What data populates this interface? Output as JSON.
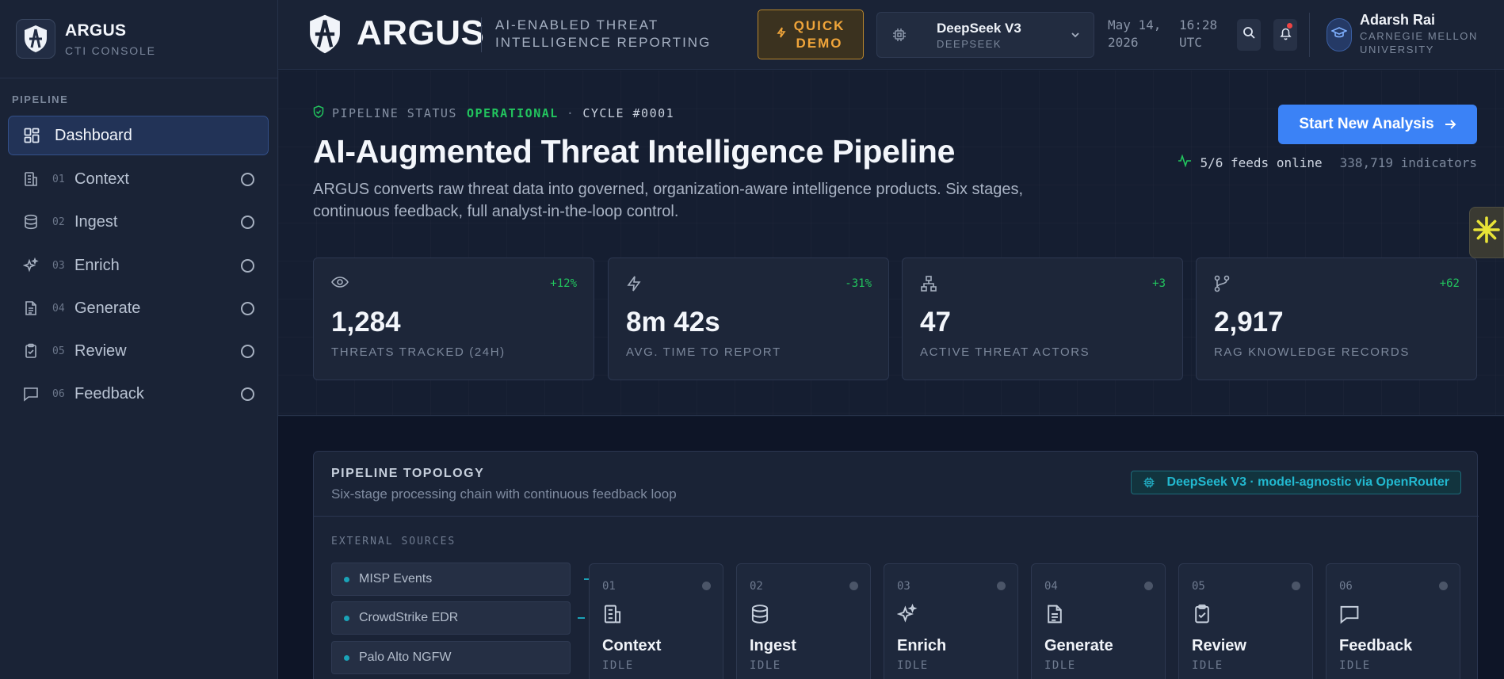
{
  "sidebar": {
    "brand": {
      "name": "ARGUS",
      "subtitle": "CTI CONSOLE"
    },
    "section_label": "PIPELINE",
    "items": [
      {
        "num": "",
        "label": "Dashboard",
        "icon": "dashboard-icon",
        "active": true
      },
      {
        "num": "01",
        "label": "Context",
        "icon": "building-icon"
      },
      {
        "num": "02",
        "label": "Ingest",
        "icon": "database-icon"
      },
      {
        "num": "03",
        "label": "Enrich",
        "icon": "sparkles-icon"
      },
      {
        "num": "04",
        "label": "Generate",
        "icon": "document-icon"
      },
      {
        "num": "05",
        "label": "Review",
        "icon": "clipboard-check-icon"
      },
      {
        "num": "06",
        "label": "Feedback",
        "icon": "message-icon"
      }
    ]
  },
  "header": {
    "name": "ARGUS",
    "tagline_line1": "AI-ENABLED THREAT",
    "tagline_line2": "INTELLIGENCE REPORTING",
    "quick_demo_line1": "QUICK",
    "quick_demo_line2": "DEMO",
    "model": {
      "name": "DeepSeek V3",
      "provider": "DEEPSEEK"
    },
    "date_line1": "May 14,",
    "date_line2": "2026",
    "time_line1": "16:28",
    "time_line2": "UTC",
    "user": {
      "name": "Adarsh Rai",
      "org_line1": "CARNEGIE MELLON",
      "org_line2": "UNIVERSITY"
    }
  },
  "hero": {
    "status_label": "PIPELINE STATUS",
    "status_value": "OPERATIONAL",
    "separator": "·",
    "cycle": "CYCLE #0001",
    "title": "AI-Augmented Threat Intelligence Pipeline",
    "description": "ARGUS converts raw threat data into governed, organization-aware intelligence products. Six stages, continuous feedback, full analyst-in-the-loop control.",
    "start_button": "Start New Analysis",
    "feeds_online": "5/6 feeds online",
    "indicators": "338,719 indicators"
  },
  "stats": [
    {
      "icon": "eye-icon",
      "delta": "+12%",
      "value": "1,284",
      "label": "THREATS TRACKED (24H)"
    },
    {
      "icon": "lightning-icon",
      "delta": "-31%",
      "value": "8m 42s",
      "label": "AVG. TIME TO REPORT"
    },
    {
      "icon": "network-icon",
      "delta": "+3",
      "value": "47",
      "label": "ACTIVE THREAT ACTORS"
    },
    {
      "icon": "git-branch-icon",
      "delta": "+62",
      "value": "2,917",
      "label": "RAG KNOWLEDGE RECORDS"
    }
  ],
  "topology": {
    "title": "PIPELINE TOPOLOGY",
    "subtitle": "Six-stage processing chain with continuous feedback loop",
    "badge": "DeepSeek V3 · model-agnostic via OpenRouter",
    "external_label": "EXTERNAL SOURCES",
    "sources": [
      "MISP Events",
      "CrowdStrike EDR",
      "Palo Alto NGFW"
    ],
    "stages": [
      {
        "num": "01",
        "name": "Context",
        "state": "IDLE"
      },
      {
        "num": "02",
        "name": "Ingest",
        "state": "IDLE"
      },
      {
        "num": "03",
        "name": "Enrich",
        "state": "IDLE"
      },
      {
        "num": "04",
        "name": "Generate",
        "state": "IDLE"
      },
      {
        "num": "05",
        "name": "Review",
        "state": "IDLE"
      },
      {
        "num": "06",
        "name": "Feedback",
        "state": "IDLE"
      }
    ]
  },
  "colors": {
    "accent": "#3b82f6",
    "success": "#22c55e",
    "warning": "#f0a53a",
    "cyan": "#22b8cf"
  }
}
